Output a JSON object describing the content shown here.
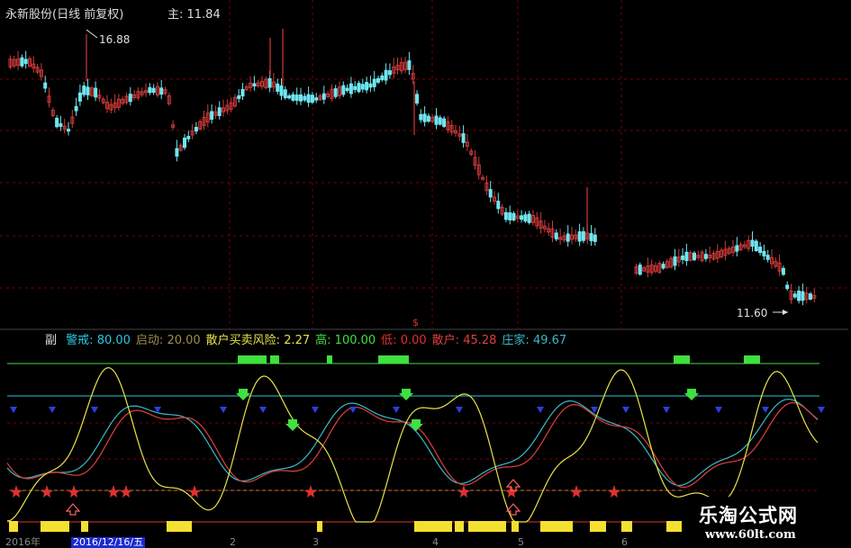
{
  "title_bar": {
    "stock_name": "永新股份(日线 前复权)",
    "main_label": "主",
    "price": ": 11.84"
  },
  "price_chart": {
    "high_label": "16.88",
    "low_label": "11.60",
    "dividend_marker": "$"
  },
  "indicator": {
    "label": "副",
    "items": [
      {
        "name": "警戒",
        "value": "80.00",
        "color": "#27c8e0"
      },
      {
        "name": "启动",
        "value": "20.00",
        "color": "#a08a4a"
      },
      {
        "name": "散户买卖风险",
        "value": "2.27",
        "color": "#e8e24a"
      },
      {
        "name": "高",
        "value": "100.00",
        "color": "#3fe03f"
      },
      {
        "name": "低",
        "value": "0.00",
        "color": "#e03030"
      },
      {
        "name": "散户",
        "value": "45.28",
        "color": "#e04040"
      },
      {
        "name": "庄家",
        "value": "49.67",
        "color": "#39b9c8"
      }
    ]
  },
  "x_axis": {
    "labels": [
      "2016年",
      "2",
      "3",
      "4",
      "5",
      "6"
    ],
    "date_badge": "2016/12/16/五"
  },
  "watermark": {
    "title": "乐淘公式网",
    "url": "www.60lt.com"
  },
  "colors": {
    "up_candle": "#d03a3a",
    "down_candle": "#6fe6f0",
    "grid": "#7a0000",
    "warn_line": "#27c8e0",
    "high_line": "#3fe03f",
    "low_line": "#e03030"
  }
}
